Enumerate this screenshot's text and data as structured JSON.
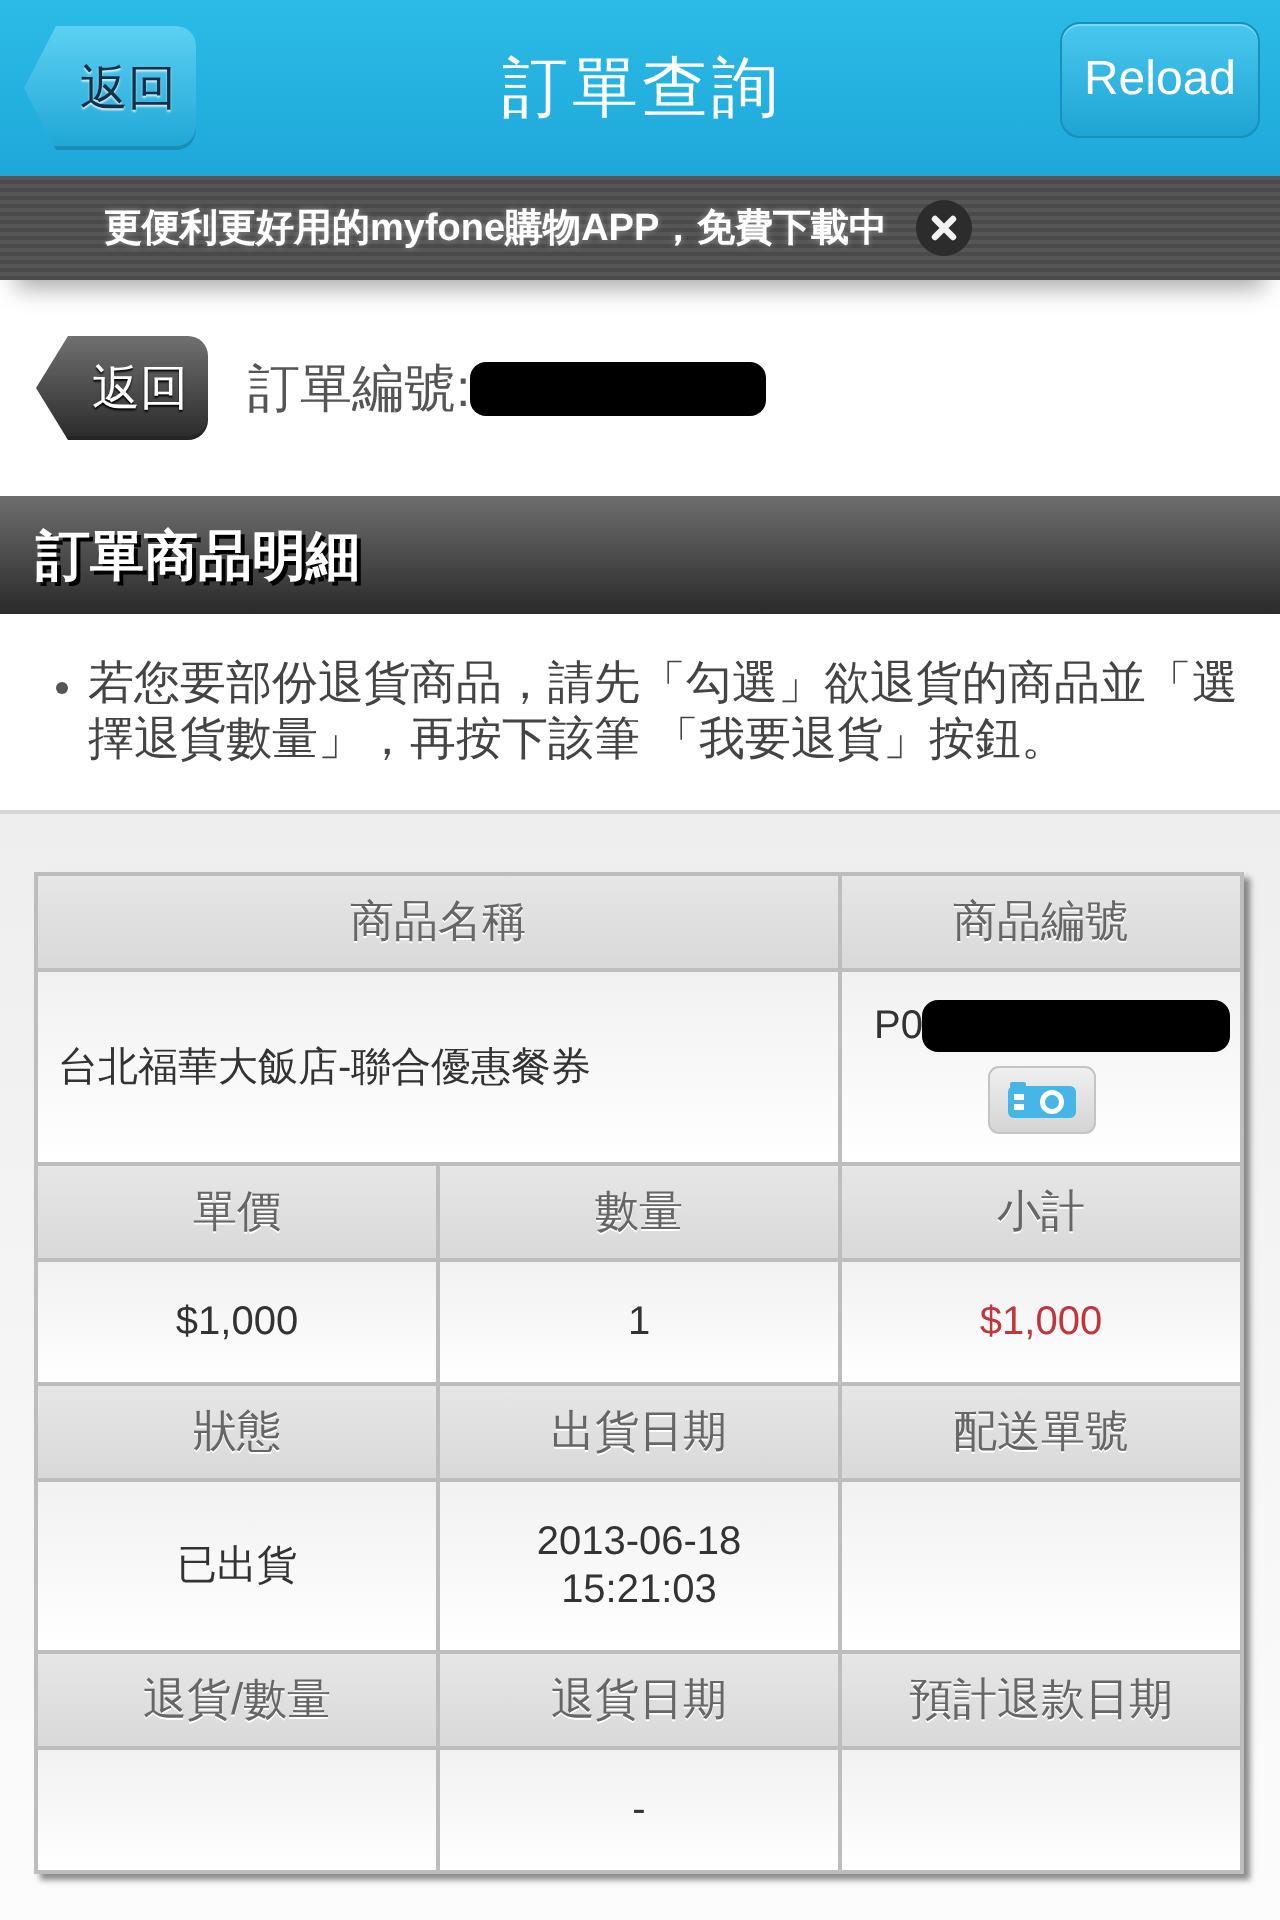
{
  "top_bar": {
    "back_button": "返回",
    "title": "訂單查詢",
    "reload_button": "Reload"
  },
  "banner": {
    "text": "更便利更好用的myfone購物APP，免費下載中"
  },
  "order": {
    "back_button": "返回",
    "label": "訂單編號:",
    "redacted": true
  },
  "section": {
    "title": "訂單商品明細"
  },
  "notes": [
    "若您要部份退貨商品，請先「勾選」欲退貨的商品並「選擇退貨數量」，再按下該筆 「我要退貨」按鈕。"
  ],
  "table": {
    "product": {
      "name_header": "商品名稱",
      "code_header": "商品編號",
      "name": "台北福華大飯店-聯合優惠餐券",
      "code": "P0",
      "code_redacted": true
    },
    "sections": [
      {
        "columns": [
          {
            "header": "單價",
            "value": "$1,000",
            "emphasis": false
          },
          {
            "header": "數量",
            "value": "1",
            "emphasis": false
          },
          {
            "header": "小計",
            "value": "$1,000",
            "emphasis": true
          }
        ]
      },
      {
        "columns": [
          {
            "header": "狀態",
            "value": "已出貨",
            "emphasis": false
          },
          {
            "header": "出貨日期",
            "value": "2013-06-18 15:21:03",
            "emphasis": false
          },
          {
            "header": "配送單號"
          }
        ]
      },
      {
        "columns": [
          {
            "header": "退貨/數量"
          },
          {
            "header": "退貨日期",
            "value": "-",
            "emphasis": false
          },
          {
            "header": "預計退款日期"
          }
        ]
      }
    ]
  }
}
